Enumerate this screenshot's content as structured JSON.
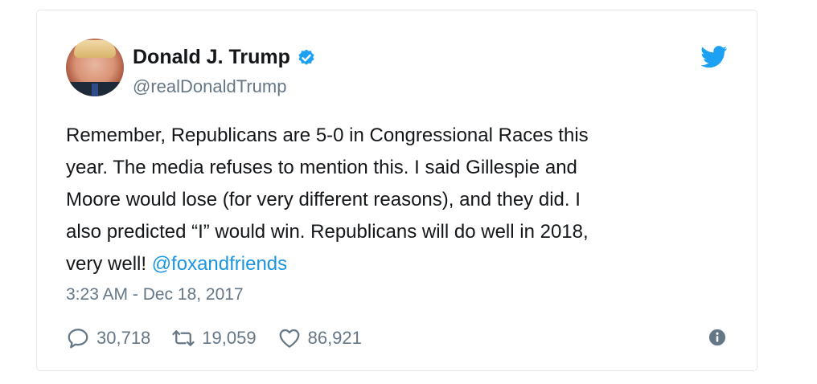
{
  "tweet": {
    "author_name": "Donald J. Trump",
    "author_handle": "@realDonaldTrump",
    "text": "Remember, Republicans are 5-0 in Congressional Races this\nyear. The media refuses to mention this. I said Gillespie and\nMoore would lose (for very different reasons), and they did. I\nalso predicted “I” would win. Republicans will do well in 2018,\nvery well! ",
    "mention": "@foxandfriends",
    "timestamp": "3:23 AM - Dec 18, 2017",
    "replies": "30,718",
    "retweets": "19,059",
    "likes": "86,921"
  },
  "colors": {
    "link": "#1b95e0",
    "secondary_text": "#657786",
    "twitter_blue": "#1da1f2",
    "border": "#e1e8ed"
  },
  "icons": {
    "verified": "verified-badge-icon",
    "brand": "twitter-bird-icon",
    "reply": "reply-icon",
    "retweet": "retweet-icon",
    "like": "heart-icon",
    "info": "info-icon"
  }
}
